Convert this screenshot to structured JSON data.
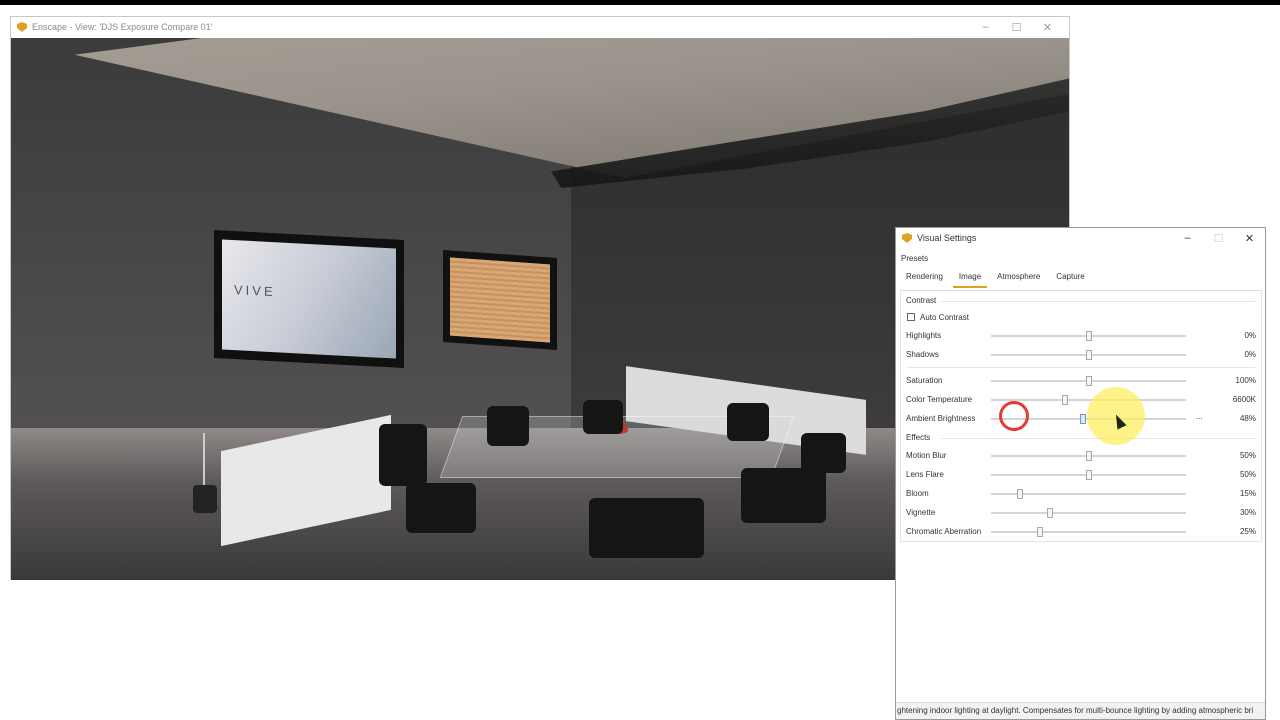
{
  "enscape_window": {
    "title": "Enscape - View: 'DJS Exposure Compare 01'",
    "controls": {
      "minimize": "–",
      "maximize": "☐",
      "close": "✕"
    },
    "scene": {
      "tv_brand": "VIVE"
    }
  },
  "visual_settings": {
    "title": "Visual Settings",
    "controls": {
      "minimize": "–",
      "maximize": "☐",
      "close": "✕"
    },
    "presets_label": "Presets",
    "tabs": [
      {
        "label": "Rendering",
        "active": false
      },
      {
        "label": "Image",
        "active": true
      },
      {
        "label": "Atmosphere",
        "active": false
      },
      {
        "label": "Capture",
        "active": false
      }
    ],
    "contrast": {
      "label": "Contrast",
      "auto_contrast": {
        "label": "Auto Contrast",
        "checked": false
      },
      "highlights": {
        "label": "Highlights",
        "value": "0%",
        "level": 0.5
      },
      "shadows": {
        "label": "Shadows",
        "value": "0%",
        "level": 0.5
      }
    },
    "color": {
      "saturation": {
        "label": "Saturation",
        "value": "100%",
        "level": 0.5
      },
      "color_temperature": {
        "label": "Color Temperature",
        "value": "6600K",
        "level": 0.38
      },
      "ambient_brightness": {
        "label": "Ambient Brightness",
        "value": "48%",
        "level": 0.47,
        "more": "..."
      }
    },
    "effects": {
      "label": "Effects",
      "motion_blur": {
        "label": "Motion Blur",
        "value": "50%",
        "level": 0.5
      },
      "lens_flare": {
        "label": "Lens Flare",
        "value": "50%",
        "level": 0.5
      },
      "bloom": {
        "label": "Bloom",
        "value": "15%",
        "level": 0.15
      },
      "vignette": {
        "label": "Vignette",
        "value": "30%",
        "level": 0.3
      },
      "chromatic_aberration": {
        "label": "Chromatic Aberration",
        "value": "25%",
        "level": 0.25
      }
    },
    "status_text": "ghtening indoor lighting at daylight. Compensates for multi-bounce lighting by adding atmospheric bri"
  },
  "colors": {
    "accent": "#e0a020",
    "click_ring": "#e53935",
    "highlight": "#fcee5a"
  }
}
